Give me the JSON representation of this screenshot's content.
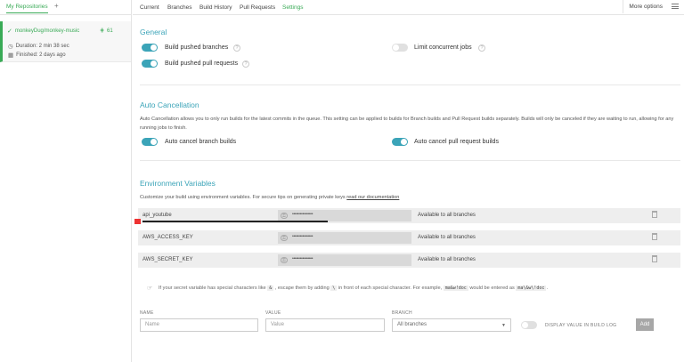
{
  "sidebar": {
    "tab_my_repos": "My Repositories",
    "tab_add": "+",
    "repo": {
      "name": "monkeyDug/monkey-music",
      "build_number": "61",
      "duration": "Duration: 2 min 38 sec",
      "finished": "Finished: 2 days ago"
    }
  },
  "nav": {
    "tabs": [
      "Current",
      "Branches",
      "Build History",
      "Pull Requests",
      "Settings"
    ],
    "active": "Settings",
    "more_options": "More options"
  },
  "general": {
    "heading": "General",
    "build_pushed_branches": "Build pushed branches",
    "build_pushed_pull_requests": "Build pushed pull requests",
    "limit_concurrent_jobs": "Limit concurrent jobs",
    "help": "?"
  },
  "auto_cancel": {
    "heading": "Auto Cancellation",
    "description": "Auto Cancellation allows you to only run builds for the latest commits in the queue. This setting can be applied to builds for Branch builds and Pull Request builds separately. Builds will only be canceled if they are waiting to run, allowing for any running jobs to finish.",
    "branch_builds": "Auto cancel branch builds",
    "pull_request_builds": "Auto cancel pull request builds"
  },
  "env": {
    "heading": "Environment Variables",
    "intro": "Customize your build using environment variables. For secure tips on generating private keys",
    "intro_link": "read our documentation",
    "rows": [
      {
        "name": "api_youtube",
        "value": "••••••••••••••••",
        "scope": "Available to all branches"
      },
      {
        "name": "AWS_ACCESS_KEY",
        "value": "••••••••••••••••",
        "scope": "Available to all branches"
      },
      {
        "name": "AWS_SECRET_KEY",
        "value": "••••••••••••••••",
        "scope": "Available to all branches"
      }
    ],
    "hint_pre": "If your secret variable has special characters like",
    "hint_amp": "&",
    "hint_mid1": ", escape them by adding",
    "hint_bs": "\\",
    "hint_mid2": "in front of each special character. For example,",
    "hint_ex1": "ma&w!doc",
    "hint_mid3": "would be entered as",
    "hint_ex2": "ma\\&w\\!doc",
    "hint_end": ".",
    "form": {
      "name_label": "NAME",
      "value_label": "VALUE",
      "branch_label": "BRANCH",
      "name_placeholder": "Name",
      "value_placeholder": "Value",
      "branch_selected": "All branches",
      "display_label": "DISPLAY VALUE IN BUILD LOG",
      "add_label": "Add"
    }
  },
  "colors": {
    "accent": "#3ba4b8",
    "success": "#39aa56"
  }
}
